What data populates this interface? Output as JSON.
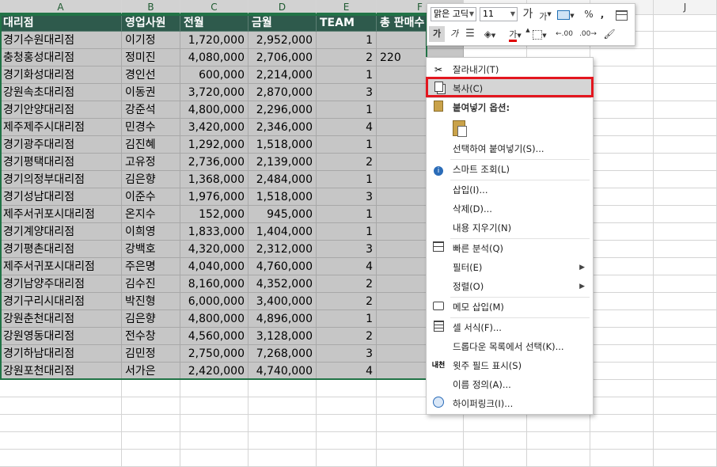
{
  "columns": [
    "A",
    "B",
    "C",
    "D",
    "E",
    "F",
    "",
    "",
    "",
    "J"
  ],
  "table": {
    "headers": [
      "대리점",
      "영업사원",
      "전월",
      "금월",
      "TEAM",
      "총 판매수"
    ],
    "rows": [
      [
        "경기수원대리점",
        "이기정",
        "1,720,000",
        "2,952,000",
        "1",
        ""
      ],
      [
        "충청홍성대리점",
        "정미진",
        "4,080,000",
        "2,706,000",
        "2",
        "220"
      ],
      [
        "경기화성대리점",
        "경인선",
        "600,000",
        "2,214,000",
        "1",
        ""
      ],
      [
        "강원속초대리점",
        "이동권",
        "3,720,000",
        "2,870,000",
        "3",
        ""
      ],
      [
        "경기안양대리점",
        "강준석",
        "4,800,000",
        "2,296,000",
        "1",
        ""
      ],
      [
        "제주제주시대리점",
        "민경수",
        "3,420,000",
        "2,346,000",
        "4",
        ""
      ],
      [
        "경기광주대리점",
        "김진혜",
        "1,292,000",
        "1,518,000",
        "1",
        ""
      ],
      [
        "경기평택대리점",
        "고유정",
        "2,736,000",
        "2,139,000",
        "2",
        ""
      ],
      [
        "경기의정부대리점",
        "김은향",
        "1,368,000",
        "2,484,000",
        "1",
        ""
      ],
      [
        "경기성남대리점",
        "이준수",
        "1,976,000",
        "1,518,000",
        "3",
        ""
      ],
      [
        "제주서귀포시대리점",
        "온지수",
        "152,000",
        "945,000",
        "1",
        ""
      ],
      [
        "경기계양대리점",
        "이희영",
        "1,833,000",
        "1,404,000",
        "1",
        ""
      ],
      [
        "경기평촌대리점",
        "강백호",
        "4,320,000",
        "2,312,000",
        "3",
        ""
      ],
      [
        "제주서귀포시대리점",
        "주은명",
        "4,040,000",
        "4,760,000",
        "4",
        ""
      ],
      [
        "경기남양주대리점",
        "김수진",
        "8,160,000",
        "4,352,000",
        "2",
        ""
      ],
      [
        "경기구리시대리점",
        "박진형",
        "6,000,000",
        "3,400,000",
        "2",
        ""
      ],
      [
        "강원춘천대리점",
        "김은향",
        "4,800,000",
        "4,896,000",
        "1",
        ""
      ],
      [
        "강원영동대리점",
        "전수창",
        "4,560,000",
        "3,128,000",
        "2",
        ""
      ],
      [
        "경기하남대리점",
        "김민정",
        "2,750,000",
        "7,268,000",
        "3",
        ""
      ],
      [
        "강원포천대리점",
        "서가은",
        "2,420,000",
        "4,740,000",
        "4",
        ""
      ]
    ]
  },
  "mini_toolbar": {
    "font": "맑은 고딕",
    "size": "11",
    "grow": "가",
    "shrink": "가",
    "percent": "%",
    "comma": ",",
    "bold": "가",
    "font_color": "가",
    "dec_inc": ".00",
    "dec_dec": ".00"
  },
  "context_menu": {
    "items": [
      {
        "label": "잘라내기(T)",
        "icon": "scissors-icon"
      },
      {
        "label": "복사(C)",
        "icon": "copy-icon"
      },
      {
        "label": "붙여넣기 옵션:",
        "icon": "paste-icon"
      },
      {
        "label": "",
        "icon": "paste-clipboard-icon"
      },
      {
        "label": "선택하여 붙여넣기(S)...",
        "icon": ""
      },
      {
        "label": "스마트 조회(L)",
        "icon": "smart-lookup-icon"
      },
      {
        "label": "삽입(I)...",
        "icon": ""
      },
      {
        "label": "삭제(D)...",
        "icon": ""
      },
      {
        "label": "내용 지우기(N)",
        "icon": ""
      },
      {
        "label": "빠른 분석(Q)",
        "icon": "quick-analysis-icon"
      },
      {
        "label": "필터(E)",
        "icon": ""
      },
      {
        "label": "정렬(O)",
        "icon": ""
      },
      {
        "label": "메모 삽입(M)",
        "icon": "comment-icon"
      },
      {
        "label": "셀 서식(F)...",
        "icon": "format-cells-icon"
      },
      {
        "label": "드롭다운 목록에서 선택(K)...",
        "icon": ""
      },
      {
        "label": "윗주 필드 표시(S)",
        "icon": "phonetic-icon"
      },
      {
        "label": "이름 정의(A)...",
        "icon": ""
      },
      {
        "label": "하이퍼링크(I)...",
        "icon": "hyperlink-icon"
      }
    ]
  },
  "colors": {
    "header_fill": "#2e5a4c",
    "selection": "#c6c6c6",
    "highlight_box": "#e3161f"
  }
}
